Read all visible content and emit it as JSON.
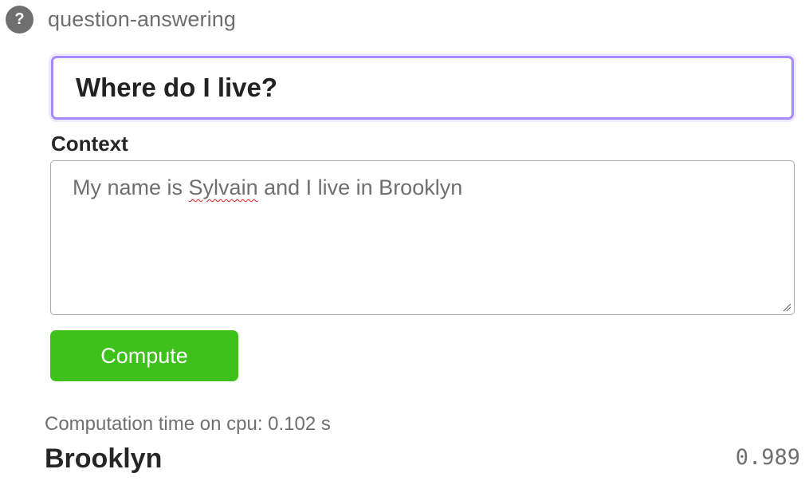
{
  "task": {
    "help_icon": "question-mark-icon",
    "help_glyph": "?",
    "name": "question-answering"
  },
  "question": {
    "value": "Where do I live?"
  },
  "context": {
    "label": "Context",
    "before": "My name is ",
    "flagged_word": "Sylvain",
    "after": " and I live in Brooklyn"
  },
  "compute": {
    "label": "Compute",
    "color": "#3ec11a"
  },
  "result": {
    "computation_time": "Computation time on cpu: 0.102 s",
    "answer": "Brooklyn",
    "score": "0.989"
  },
  "colors": {
    "focus_border": "#a78bfa",
    "spell_error": "#e02020"
  }
}
